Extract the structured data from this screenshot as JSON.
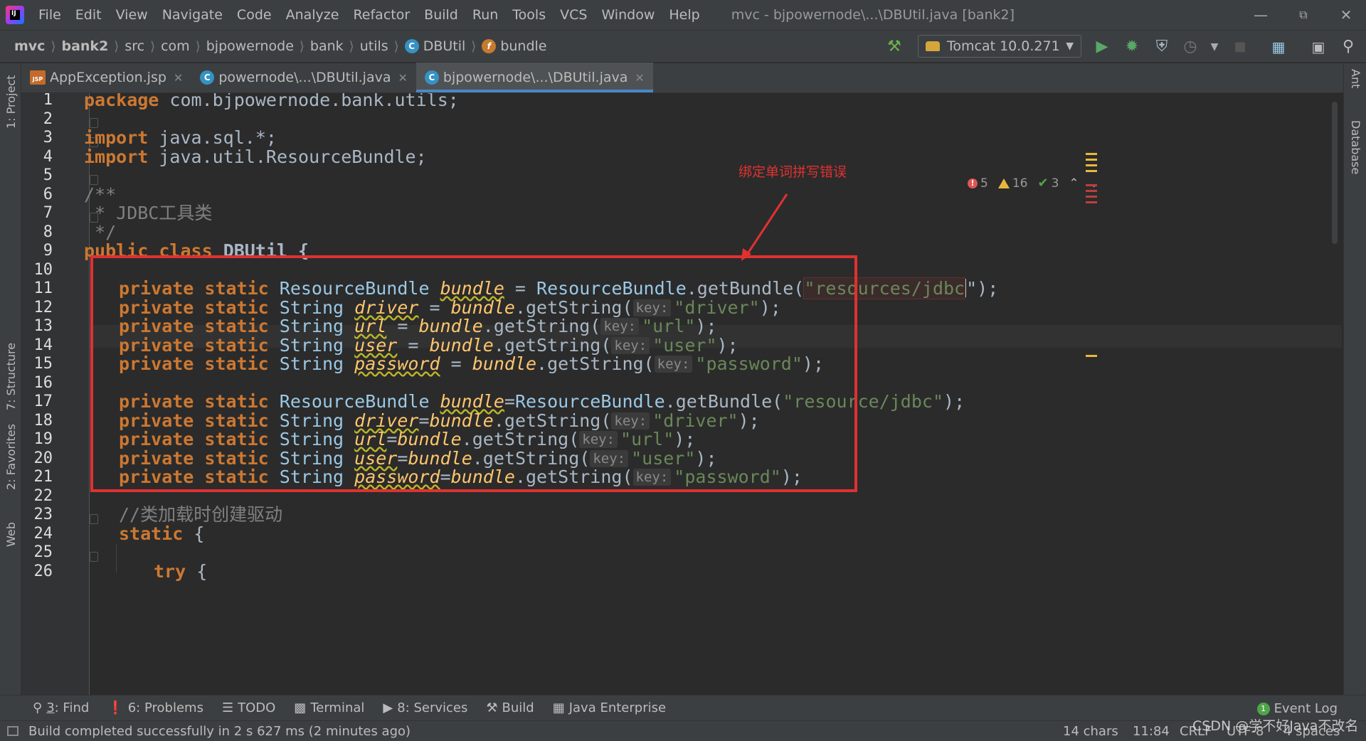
{
  "menubar": {
    "items": [
      "File",
      "Edit",
      "View",
      "Navigate",
      "Code",
      "Analyze",
      "Refactor",
      "Build",
      "Run",
      "Tools",
      "VCS",
      "Window",
      "Help"
    ],
    "window_title": "mvc - bjpowernode\\...\\DBUtil.java [bank2]"
  },
  "navbar": {
    "breadcrumbs": [
      "mvc",
      "bank2",
      "src",
      "com",
      "bjpowernode",
      "bank",
      "utils",
      "DBUtil",
      "bundle"
    ],
    "run_config": "Tomcat 10.0.271"
  },
  "tabs": [
    {
      "label": "AppException.jsp",
      "icon": "jsp-icon"
    },
    {
      "label": "powernode\\...\\DBUtil.java",
      "icon": "class-icon"
    },
    {
      "label": "bjpowernode\\...\\DBUtil.java",
      "icon": "class-icon",
      "active": true
    }
  ],
  "left_strip": [
    "1: Project",
    "7: Structure",
    "2: Favorites",
    "Web"
  ],
  "right_strip": [
    "Ant",
    "Database"
  ],
  "inspection": {
    "errors": "5",
    "warnings": "16",
    "weak": "3"
  },
  "code": {
    "line_numbers": [
      "1",
      "2",
      "3",
      "4",
      "5",
      "6",
      "7",
      "8",
      "9",
      "10",
      "11",
      "12",
      "13",
      "14",
      "15",
      "16",
      "17",
      "18",
      "19",
      "20",
      "21",
      "22",
      "23",
      "24",
      "25",
      "26"
    ],
    "hint_label": "key:",
    "l1": {
      "kw": "package",
      "rest": "com.bjpowernode.bank.utils;"
    },
    "l3": {
      "kw": "import",
      "rest": "java.sql.*;"
    },
    "l4": {
      "kw": "import",
      "rest": "java.util.ResourceBundle;"
    },
    "l6": "/**",
    "l7": " * JDBC工具类",
    "l8": " */",
    "l9": {
      "kw": "public class",
      "rest": "DBUtil {"
    },
    "l11": {
      "mods": "private static",
      "type": "ResourceBundle",
      "field": "bundle",
      "eq": " = ",
      "cls": "ResourceBundle",
      "call": ".getBundle(",
      "str": "\"resources/jdbc",
      "tail": "\");"
    },
    "l12": {
      "mods": "private static",
      "type": "String",
      "field": "driver",
      "eq": " = ",
      "src": "bundle",
      "call": ".getString(",
      "str": "\"driver\"",
      "tail": ");"
    },
    "l13": {
      "mods": "private static",
      "type": "String",
      "field": "url",
      "eq": " = ",
      "src": "bundle",
      "call": ".getString(",
      "str": "\"url\"",
      "tail": ");"
    },
    "l14": {
      "mods": "private static",
      "type": "String",
      "field": "user",
      "eq": " = ",
      "src": "bundle",
      "call": ".getString(",
      "str": "\"user\"",
      "tail": ");"
    },
    "l15": {
      "mods": "private static",
      "type": "String",
      "field": "password",
      "eq": " = ",
      "src": "bundle",
      "call": ".getString(",
      "str": "\"password\"",
      "tail": ");"
    },
    "l17": {
      "mods": "private static",
      "type": "ResourceBundle",
      "field": "bundle",
      "eq": "=",
      "cls": "ResourceBundle",
      "call": ".getBundle(",
      "str": "\"resource/jdbc\"",
      "tail": ");"
    },
    "l18": {
      "mods": "private static",
      "type": "String",
      "field": "driver",
      "eq": "=",
      "src": "bundle",
      "call": ".getString(",
      "str": "\"driver\"",
      "tail": ");"
    },
    "l19": {
      "mods": "private static",
      "type": "String",
      "field": "url",
      "eq": "=",
      "src": "bundle",
      "call": ".getString(",
      "str": "\"url\"",
      "tail": ");"
    },
    "l20": {
      "mods": "private static",
      "type": "String",
      "field": "user",
      "eq": "=",
      "src": "bundle",
      "call": ".getString(",
      "str": "\"user\"",
      "tail": ");"
    },
    "l21": {
      "mods": "private static",
      "type": "String",
      "field": "password",
      "eq": "=",
      "src": "bundle",
      "call": ".getString(",
      "str": "\"password\"",
      "tail": ");"
    },
    "l23": "//类加载时创建驱动",
    "l24": {
      "kw": "static",
      "rest": " {"
    },
    "l26": {
      "kw": "try",
      "rest": " {"
    }
  },
  "annotation": {
    "note": "绑定单词拼写错误",
    "color": "#e03131"
  },
  "bottom_tools": [
    "6: Problems",
    "TODO",
    "Terminal",
    "8: Services",
    "Build",
    "Java Enterprise"
  ],
  "find_tool": {
    "num": "3",
    "label": ": Find"
  },
  "event_log": {
    "count": "1",
    "label": "Event Log"
  },
  "status": {
    "message": "Build completed successfully in 2 s 627 ms (2 minutes ago)",
    "chars": "14 chars",
    "position": "11:84",
    "line_sep": "CRLF",
    "encoding": "UTF-8",
    "indent": "4 spaces"
  },
  "watermark": "CSDN @学不好Java不改名"
}
